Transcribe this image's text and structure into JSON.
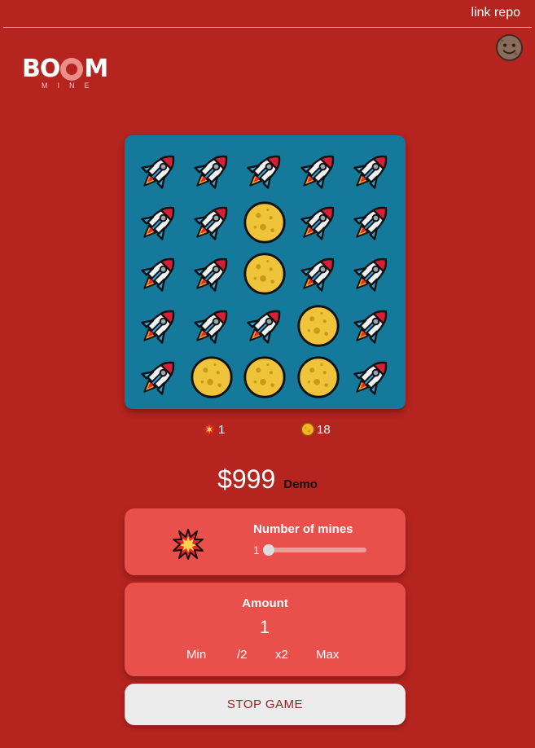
{
  "header": {
    "link_label": "link repo",
    "avatar_icon": "moon-face-icon"
  },
  "logo": {
    "word": "BOOM",
    "sub": "MINE",
    "accent": "#ea8f8a"
  },
  "board": {
    "background": "#14799a",
    "icons": {
      "safe": "rocket-icon",
      "revealed": "moon-icon"
    },
    "grid": [
      [
        "rocket",
        "rocket",
        "rocket",
        "rocket",
        "rocket"
      ],
      [
        "rocket",
        "rocket",
        "moon",
        "rocket",
        "rocket"
      ],
      [
        "rocket",
        "rocket",
        "moon",
        "rocket",
        "rocket"
      ],
      [
        "rocket",
        "rocket",
        "rocket",
        "moon",
        "rocket"
      ],
      [
        "rocket",
        "moon",
        "moon",
        "moon",
        "rocket"
      ]
    ]
  },
  "stats": {
    "mines_icon": "collision-icon",
    "mines_count": "1",
    "gems_icon": "coin-icon",
    "gems_count": "18"
  },
  "balance": {
    "amount": "$999",
    "mode": "Demo"
  },
  "mines_panel": {
    "title": "Number of mines",
    "value": "1",
    "slider_fraction": 0.0,
    "icon": "collision-icon"
  },
  "amount_panel": {
    "title": "Amount",
    "value": "1",
    "buttons": {
      "min": "Min",
      "half": "/2",
      "double": "x2",
      "max": "Max"
    }
  },
  "actions": {
    "stop_label": "STOP GAME"
  },
  "colors": {
    "background": "#b5241f",
    "panel": "#e9504c",
    "stop_text": "#8e2420"
  }
}
